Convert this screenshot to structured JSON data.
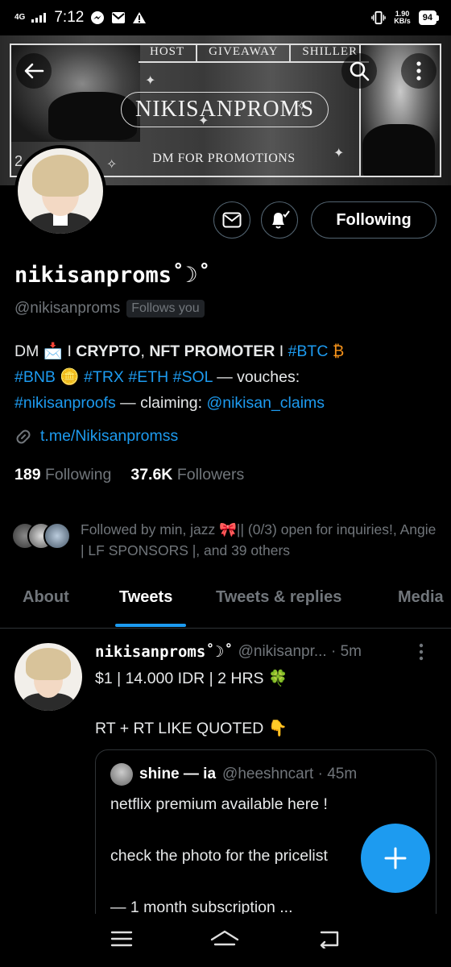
{
  "status_bar": {
    "network": "4G",
    "time": "7:12",
    "speed_value": "1.90",
    "speed_unit": "KB/s",
    "battery": "94"
  },
  "banner": {
    "tabs": [
      "HOST",
      "GIVEAWAY",
      "SHILLER"
    ],
    "title": "NIKISANPROMS",
    "subtitle": "DM FOR PROMOTIONS",
    "corner_number": "2"
  },
  "profile": {
    "display_name": "nikisanproms˚☽˚",
    "handle": "@nikisanproms",
    "follows_you": "Follows you",
    "bio": {
      "p1": "DM 📩 I ",
      "p2": "CRYPTO",
      "p3": ", ",
      "p4": "NFT PROMOTER",
      "p5": " I ",
      "tag_btc": "#BTC",
      "emoji_btc": " ₿",
      "tag_bnb": "#BNB",
      "emoji_bnb": " 🪙 ",
      "tag_trx": "#TRX",
      "tag_eth": "#ETH",
      "tag_sol": "#SOL",
      "p6": " — vouches:",
      "tag_proofs": "#nikisanproofs",
      "p7": " — claiming: ",
      "mention_claims": "@nikisan_claims"
    },
    "link": "t.me/Nikisanpromss",
    "following_count": "189",
    "following_label": "Following",
    "followers_count": "37.6K",
    "followers_label": "Followers",
    "followed_by_text": "Followed by min, jazz 🎀|| (0/3) open for inquiries!, Angie | LF SPONSORS |, and 39 others",
    "follow_button": "Following"
  },
  "tabs": [
    "About",
    "Tweets",
    "Tweets & replies",
    "Media"
  ],
  "active_tab": "Tweets",
  "tweet": {
    "name": "nikisanproms˚☽˚",
    "handle_time": "@nikisanpr... · 5m",
    "line1": "$1 | 14.000 IDR | 2 HRS 🍀",
    "line2": "RT + RT LIKE QUOTED 👇",
    "quote": {
      "name": "shine — ia",
      "handle_time": "@heeshncart · 45m",
      "line1": "netflix premium available here !",
      "line2": "check the photo for the pricelist",
      "line3": "— 1 month subscription ..."
    }
  },
  "colors": {
    "accent": "#1d9bf0",
    "muted": "#71767b",
    "background": "#000000"
  },
  "icons": [
    "back-arrow-icon",
    "search-icon",
    "more-vertical-icon",
    "mail-icon",
    "bell-check-icon",
    "link-icon",
    "compose-plus-icon",
    "menu-icon",
    "home-icon",
    "back-icon"
  ]
}
